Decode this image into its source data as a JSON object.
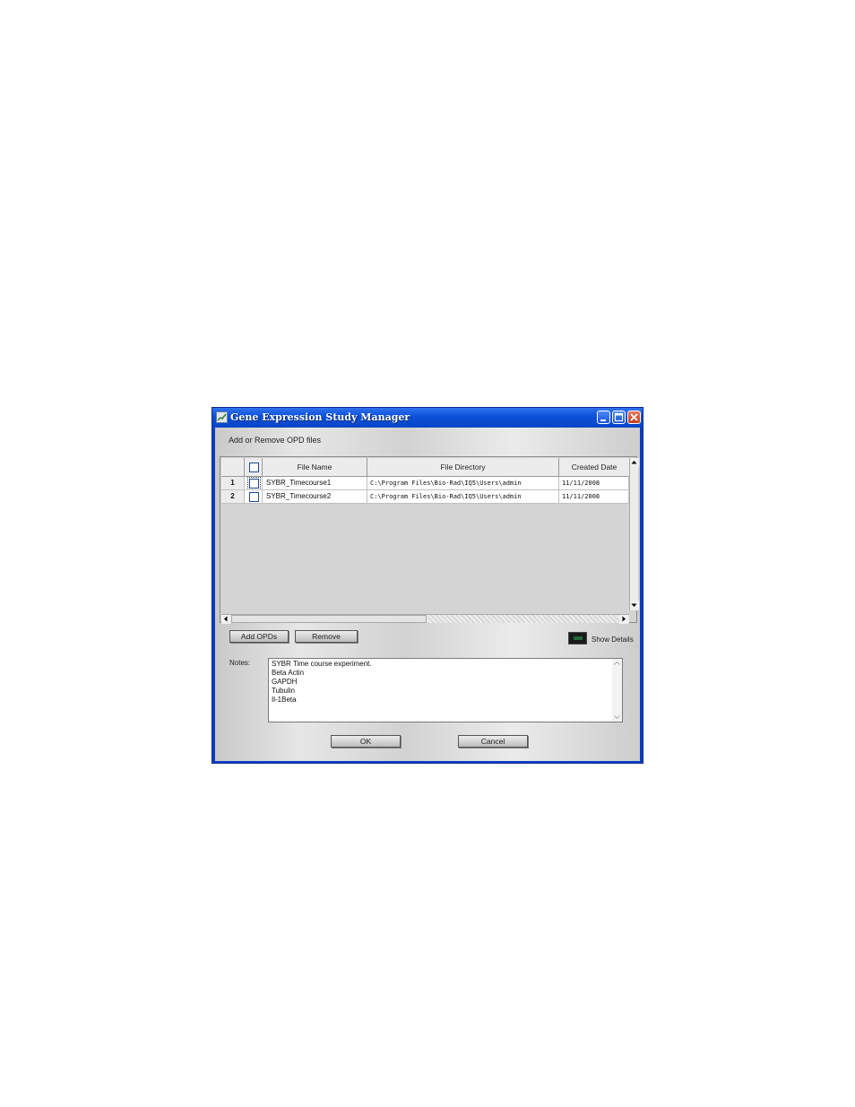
{
  "window": {
    "title": "Gene Expression Study  Manager"
  },
  "section_label": "Add or Remove OPD files",
  "table": {
    "headers": [
      "",
      "",
      "File Name",
      "File Directory",
      "Created Date"
    ],
    "rows": [
      {
        "num": "1",
        "file_name": "SYBR_Timecourse1",
        "directory": "C:\\Program Files\\Bio-Rad\\IQ5\\Users\\admin",
        "created": "11/11/2008"
      },
      {
        "num": "2",
        "file_name": "SYBR_Timecourse2",
        "directory": "C:\\Program Files\\Bio-Rad\\IQ5\\Users\\admin",
        "created": "11/11/2008"
      }
    ]
  },
  "buttons": {
    "add": "Add OPDs",
    "remove": "Remove",
    "ok": "OK",
    "cancel": "Cancel"
  },
  "show_details": {
    "label": "Show Details"
  },
  "notes": {
    "label": "Notes:",
    "lines": [
      "SYBR Time course experiment.",
      "Beta Actin",
      "GAPDH",
      "Tubulin",
      "Il-1Beta"
    ]
  },
  "colors": {
    "titlebar": "#0b4fd8",
    "accent_led": "#1f6a3a"
  }
}
